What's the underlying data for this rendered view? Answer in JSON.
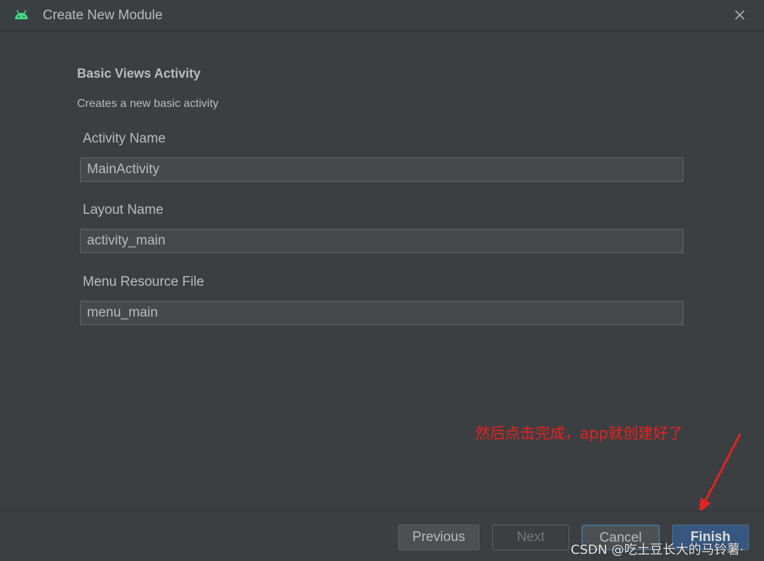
{
  "window": {
    "title": "Create New Module",
    "icon": "android-icon",
    "close_icon": "close-icon"
  },
  "header": {
    "heading": "Basic Views Activity",
    "description": "Creates a new basic activity"
  },
  "fields": [
    {
      "label": "Activity Name",
      "value": "MainActivity"
    },
    {
      "label": "Layout Name",
      "value": "activity_main"
    },
    {
      "label": "Menu Resource File",
      "value": "menu_main"
    }
  ],
  "annotation": {
    "text": "然后点击完成，app就创建好了",
    "color": "#e8201f"
  },
  "buttons": {
    "previous": "Previous",
    "next": "Next",
    "cancel": "Cancel",
    "finish": "Finish"
  },
  "watermark": "CSDN @吃土豆长大的马铃薯·",
  "colors": {
    "background": "#3c3f41",
    "input_background": "#45494a",
    "text": "#bbbbbb",
    "android_green": "#3ddc84",
    "finish_button": "#365880",
    "focus_border": "#466d94"
  }
}
